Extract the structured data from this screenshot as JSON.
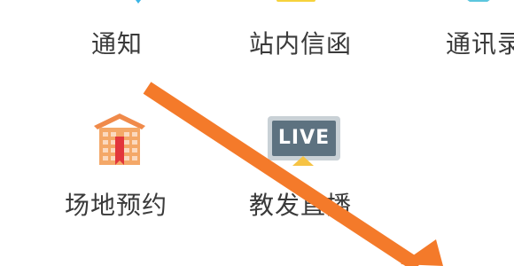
{
  "apps": {
    "notify": {
      "label": "通知",
      "icon": "notification-icon"
    },
    "inbox": {
      "label": "站内信函",
      "icon": "inbox-mail-icon"
    },
    "contacts": {
      "label": "通讯录",
      "icon": "contacts-icon"
    },
    "venue_booking": {
      "label": "场地预约",
      "icon": "building-icon"
    },
    "live_teaching": {
      "label": "教发直播",
      "icon": "live-tv-icon",
      "badge_text": "LIVE"
    }
  },
  "colors": {
    "label_text": "#3a3a3a",
    "annotation_arrow": "#f47a2a",
    "live_screen": "#5d7280",
    "building": "#f4a868",
    "ribbon": "#e2363c"
  }
}
